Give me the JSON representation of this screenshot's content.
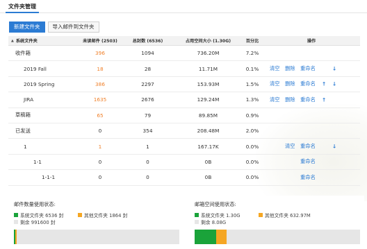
{
  "tab": {
    "label": "文件夹管理"
  },
  "toolbar": {
    "new_folder": "新建文件夹",
    "import_mail": "导入邮件到文件夹"
  },
  "table": {
    "headers": {
      "name": "系统文件夹",
      "unread": "未读邮件 (2503)",
      "total": "总封数 (6536)",
      "size": "占用空间大小 (1.30G)",
      "percent": "百分比",
      "ops": "操作"
    },
    "rows": [
      {
        "name": "收件箱",
        "unread": "396",
        "total": "1094",
        "size": "736.20M",
        "percent": "7.2%"
      },
      {
        "name": "2019 Fall",
        "unread": "18",
        "total": "28",
        "size": "11.71M",
        "percent": "0.1%",
        "clear": "清空",
        "delete": "删除",
        "rename": "重命名"
      },
      {
        "name": "2019 Spring",
        "unread": "386",
        "total": "2297",
        "size": "153.93M",
        "percent": "1.5%",
        "clear": "清空",
        "delete": "删除",
        "rename": "重命名"
      },
      {
        "name": "JIRA",
        "unread": "1635",
        "total": "2676",
        "size": "129.24M",
        "percent": "1.3%",
        "clear": "清空",
        "delete": "删除",
        "rename": "重命名"
      },
      {
        "name": "草稿箱",
        "unread": "65",
        "total": "79",
        "size": "89.85M",
        "percent": "0.9%"
      },
      {
        "name": "已发送",
        "unread": "0",
        "total": "354",
        "size": "208.48M",
        "percent": "2.0%"
      },
      {
        "name": "1",
        "unread": "1",
        "total": "1",
        "size": "167.17K",
        "percent": "0.0%",
        "clear": "清空",
        "rename": "重命名"
      },
      {
        "name": "1-1",
        "unread": "0",
        "total": "0",
        "size": "0B",
        "percent": "0.0%",
        "rename": "重命名"
      },
      {
        "name": "1-1-1",
        "unread": "0",
        "total": "0",
        "size": "0B",
        "percent": "0.0%",
        "rename": "重命名"
      }
    ]
  },
  "mail_count": {
    "title": "邮件数量使用状态:",
    "system": "系统文件夹 6536 封",
    "other": "其他文件夹 1864 封",
    "remaining": "剩余 991600 封",
    "system_fraction": 0.0065,
    "other_fraction": 0.0019
  },
  "mail_space": {
    "title": "邮箱空间使用状态:",
    "system": "系统文件夹 1.30G",
    "other": "其他文件夹 632.97M",
    "remaining": "剩余 8.08G",
    "system_fraction": 0.13,
    "other_fraction": 0.062
  },
  "colors": {
    "accent": "#2b7bd3",
    "unread": "#f0802a",
    "system": "#1aa33a",
    "other": "#f5a623",
    "remaining": "#e6e6e6"
  },
  "icons": {
    "sort": "sort-triangle-icon",
    "up": "arrow-up-icon",
    "down": "arrow-down-icon"
  }
}
